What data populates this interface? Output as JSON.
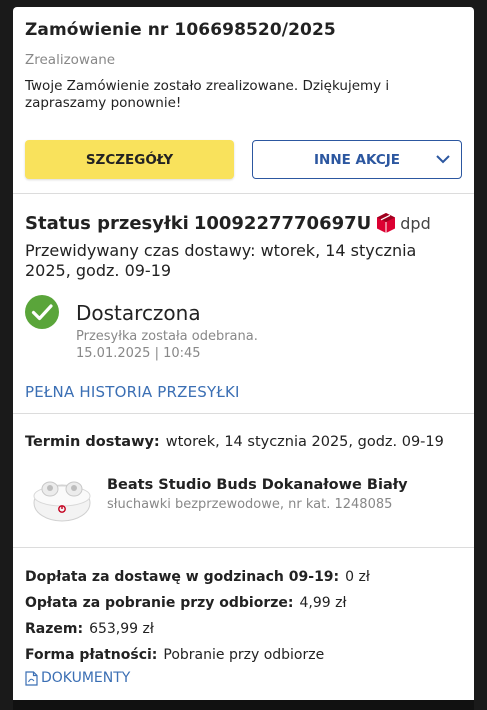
{
  "order": {
    "title": "Zamówienie nr 106698520/2025",
    "status": "Zrealizowane",
    "message": "Twoje Zamówienie zostało zrealizowane. Dziękujemy i zapraszamy ponownie!"
  },
  "actions": {
    "details_label": "SZCZEGÓŁY",
    "more_label": "INNE AKCJE"
  },
  "shipment": {
    "title_label": "Status przesyłki",
    "tracking_number": "1009227770697U",
    "carrier": "dpd",
    "eta": "Przewidywany czas dostawy: wtorek, 14 stycznia 2025, godz. 09-19",
    "state": "Dostarczona",
    "state_detail": "Przesyłka została odebrana.",
    "state_time": "15.01.2025 | 10:45",
    "history_link": "PEŁNA HISTORIA PRZESYŁKI"
  },
  "delivery": {
    "term_label": "Termin dostawy:",
    "term_value": "wtorek, 14 stycznia 2025, godz. 09-19"
  },
  "product": {
    "name": "Beats Studio Buds Dokanałowe Biały",
    "desc": "słuchawki bezprzewodowe, nr kat. 1248085"
  },
  "summary": {
    "rows": [
      {
        "label": "Dopłata za dostawę w godzinach 09-19:",
        "value": "0 zł"
      },
      {
        "label": "Opłata za pobranie przy odbiorze:",
        "value": "4,99 zł"
      },
      {
        "label": "Razem:",
        "value": "653,99 zł"
      },
      {
        "label": "Forma płatności:",
        "value": "Pobranie przy odbiorze"
      }
    ],
    "documents_label": "DOKUMENTY"
  },
  "colors": {
    "accent_yellow": "#f9e25c",
    "link_blue": "#3b6fb4",
    "success_green": "#5aa53a",
    "dpd_red": "#dc0032"
  }
}
